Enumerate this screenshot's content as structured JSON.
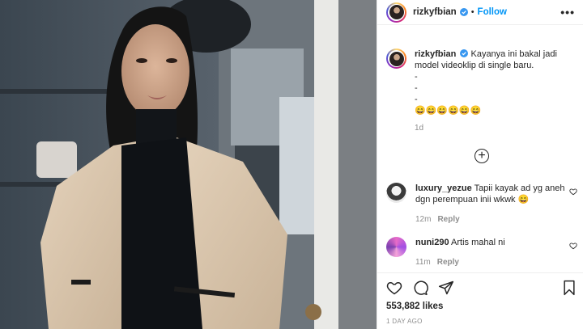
{
  "post": {
    "username": "rizkyfbian",
    "follow_label": "Follow",
    "separator": "•",
    "more_label": "•••",
    "caption": {
      "username": "rizkyfbian",
      "line1": "Kayanya ini bakal jadi",
      "line2": "model videoklip di single baru.",
      "line3": "-",
      "line4": "-",
      "line5": "-",
      "emojis": "😄😄😄😄😄😄",
      "time": "1d"
    },
    "load_more_icon": "plus-circle-icon",
    "comments": [
      {
        "username": "luxury_yezue",
        "text_line1": "Tapii kayak ad yg aneh",
        "text_line2": "dgn perempuan inii wkwk 😄",
        "time": "12m",
        "reply_label": "Reply"
      },
      {
        "username": "nuni290",
        "text_line1": "Artis mahal ni",
        "time": "11m",
        "reply_label": "Reply"
      }
    ],
    "likes": "553,882 likes",
    "time_ago": "1 DAY AGO",
    "accent_color": "#0095f6",
    "icons": [
      "heart-icon",
      "comment-icon",
      "share-icon",
      "bookmark-icon",
      "verified-badge-icon"
    ]
  }
}
